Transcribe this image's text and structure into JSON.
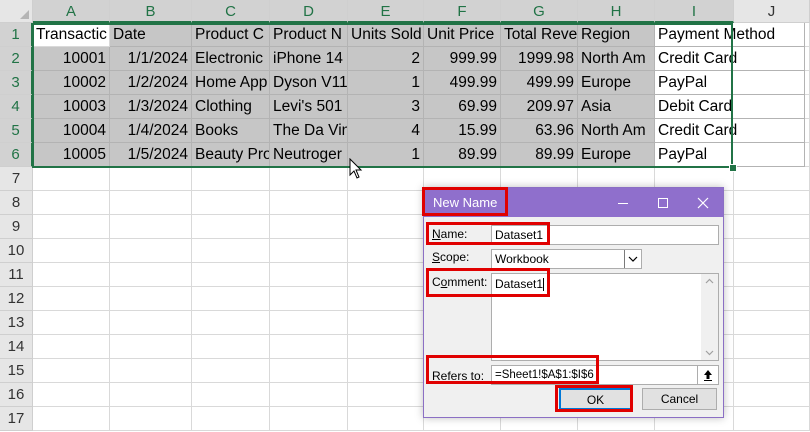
{
  "columns": [
    "A",
    "B",
    "C",
    "D",
    "E",
    "F",
    "G",
    "H",
    "I",
    "J"
  ],
  "rows": [
    "1",
    "2",
    "3",
    "4",
    "5",
    "6",
    "7",
    "8",
    "9",
    "10",
    "11",
    "12",
    "13",
    "14",
    "15",
    "16",
    "17"
  ],
  "headers": [
    "Transactic",
    "Date",
    "Product C",
    "Product N",
    "Units Sold",
    "Unit Price",
    "Total Reve",
    "Region",
    "Payment Method"
  ],
  "data": [
    [
      "10001",
      "1/1/2024",
      "Electronic",
      "iPhone 14",
      "2",
      "999.99",
      "1999.98",
      "North Am",
      "Credit Card"
    ],
    [
      "10002",
      "1/2/2024",
      "Home App",
      "Dyson V11",
      "1",
      "499.99",
      "499.99",
      "Europe",
      "PayPal"
    ],
    [
      "10003",
      "1/3/2024",
      "Clothing",
      "Levi's 501",
      "3",
      "69.99",
      "209.97",
      "Asia",
      "Debit Card"
    ],
    [
      "10004",
      "1/4/2024",
      "Books",
      "The Da Vin",
      "4",
      "15.99",
      "63.96",
      "North Am",
      "Credit Card"
    ],
    [
      "10005",
      "1/5/2024",
      "Beauty Pro",
      "Neutroger",
      "1",
      "89.99",
      "89.99",
      "Europe",
      "PayPal"
    ]
  ],
  "dialog": {
    "title": "New Name",
    "name_label_underlined": "N",
    "name_label_rest": "ame:",
    "name_value": "Dataset1",
    "scope_label_underlined": "S",
    "scope_label_rest": "cope:",
    "scope_value": "Workbook",
    "comment_label_first": "C",
    "comment_label_underlined": "o",
    "comment_label_rest": "mment:",
    "comment_value": "Dataset1",
    "refers_label_underlined": "R",
    "refers_label_rest": "efers to:",
    "refers_value": "=Sheet1!$A$1:$I$6",
    "ok_label": "OK",
    "cancel_label": "Cancel"
  },
  "colors": {
    "accent_green": "#217346",
    "dialog_titlebar": "#8f6fcc",
    "highlight_red": "#e00000"
  },
  "icons": [
    "minimize-icon",
    "maximize-icon",
    "close-icon",
    "chevron-down-icon",
    "scroll-up-icon",
    "scroll-down-icon",
    "collapse-dialog-icon",
    "mouse-cursor-icon"
  ]
}
